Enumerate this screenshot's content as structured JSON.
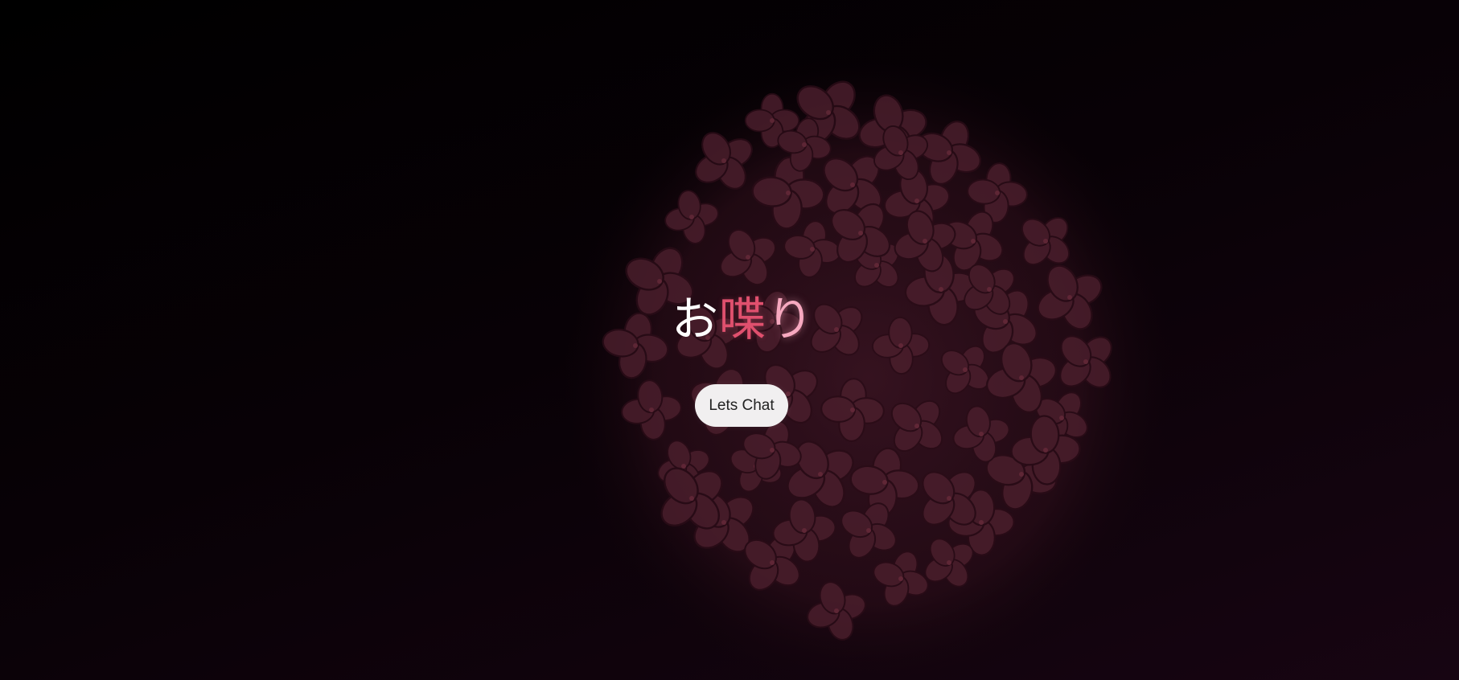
{
  "title": {
    "part1": "お",
    "part2": "喋",
    "part3": "り"
  },
  "cta": {
    "label": "Lets Chat"
  },
  "colors": {
    "background_dark": "#000000",
    "background_tint": "#170512",
    "flower": "#4a1e2c",
    "accent_red": "#e0506e",
    "accent_pink": "#f7a9c0",
    "button_bg": "#f1eff0"
  },
  "background_image": {
    "icon": "hydrangea-flower-image"
  }
}
